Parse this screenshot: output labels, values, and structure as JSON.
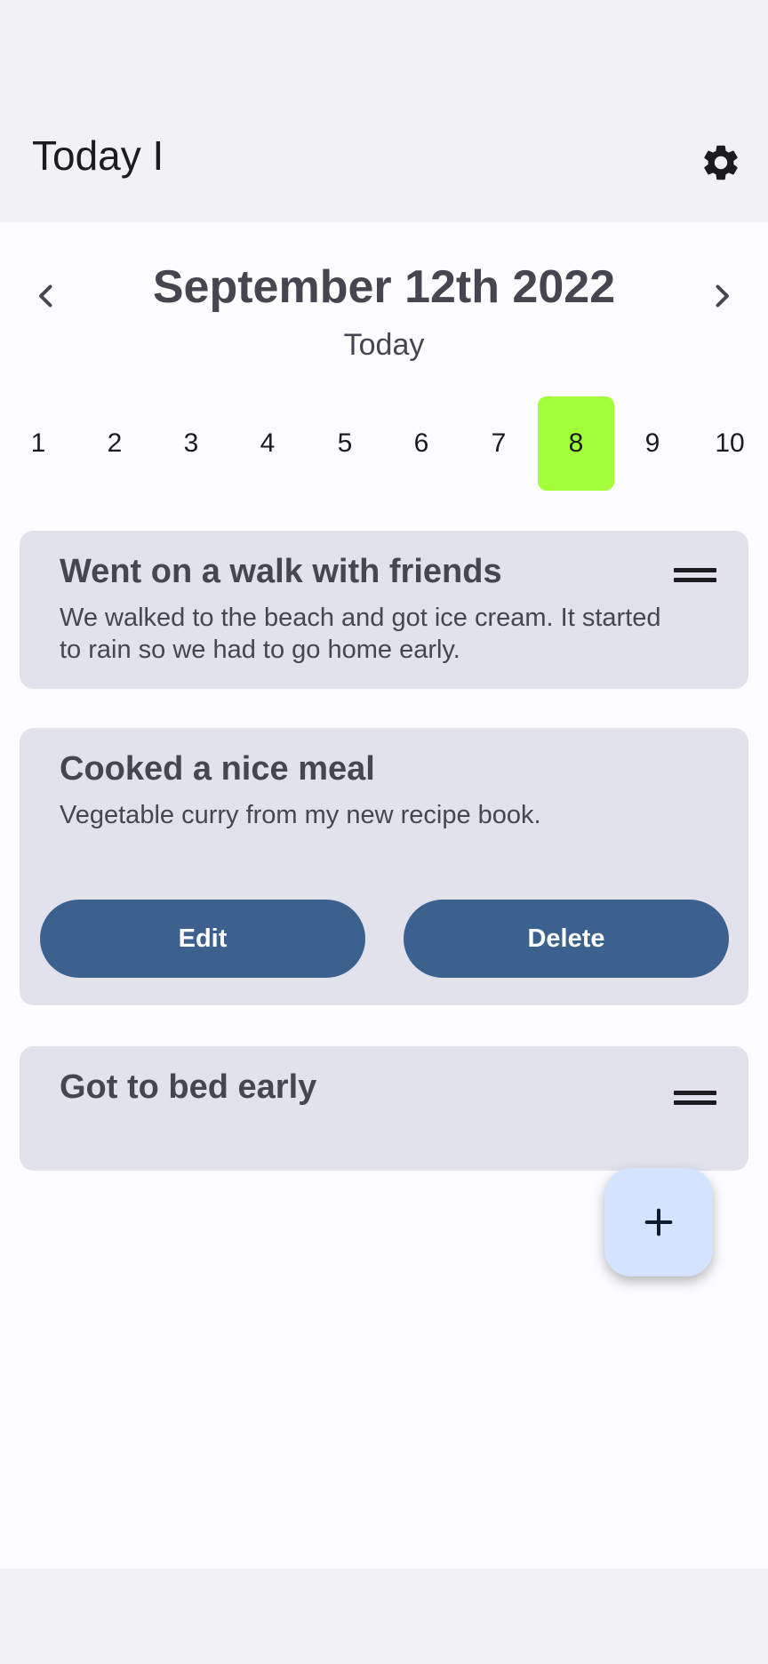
{
  "app_bar": {
    "title": "Today I",
    "settings_icon": "gear-icon"
  },
  "date_header": {
    "title": "September 12th 2022",
    "subtitle": "Today",
    "prev_icon": "chevron-left-icon",
    "next_icon": "chevron-right-icon"
  },
  "day_strip": {
    "days": [
      "1",
      "2",
      "3",
      "4",
      "5",
      "6",
      "7",
      "8",
      "9",
      "10"
    ],
    "selected": "8",
    "selected_color": "#a2ff3a"
  },
  "entries": [
    {
      "title": "Went on a walk with friends",
      "body": "We walked to the beach and got ice cream. It started to rain so we had to go home early.",
      "icon": "drag-handle-icon"
    },
    {
      "title": "Cooked a nice meal",
      "body": "Vegetable curry from my new recipe book.",
      "edit_label": "Edit",
      "delete_label": "Delete"
    },
    {
      "title": "Got to bed early",
      "icon": "drag-handle-icon"
    }
  ],
  "fab": {
    "icon": "plus-icon",
    "color": "#d4e3ff"
  },
  "colors": {
    "primary": "#3c618f",
    "card": "#e1e2eb",
    "text": "#45464f"
  }
}
